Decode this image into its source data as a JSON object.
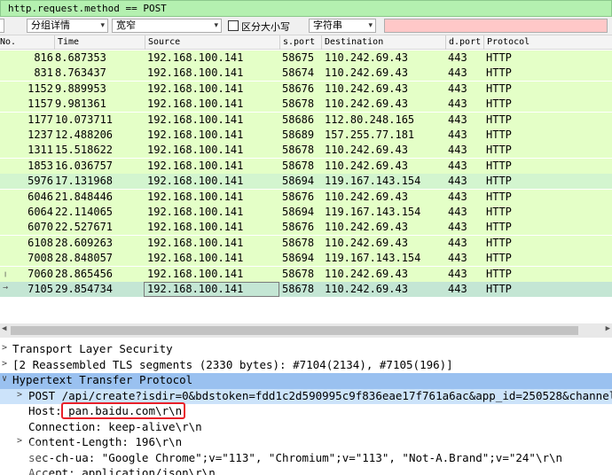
{
  "filter": {
    "text": "http.request.method == POST"
  },
  "toolbar": {
    "group_detail": "分组详情",
    "width_mode": "宽窄",
    "case_label": "区分大小写",
    "search_type": "字符串"
  },
  "columns": [
    "No.",
    "Time",
    "Source",
    "s.port",
    "Destination",
    "d.port",
    "Protocol"
  ],
  "packets": [
    {
      "no": "816",
      "time": "8.687353",
      "src": "192.168.100.141",
      "sport": "58675",
      "dst": "110.242.69.43",
      "dport": "443",
      "proto": "HTTP"
    },
    {
      "no": "831",
      "time": "8.763437",
      "src": "192.168.100.141",
      "sport": "58674",
      "dst": "110.242.69.43",
      "dport": "443",
      "proto": "HTTP"
    },
    {
      "no": "1152",
      "time": "9.889953",
      "src": "192.168.100.141",
      "sport": "58676",
      "dst": "110.242.69.43",
      "dport": "443",
      "proto": "HTTP"
    },
    {
      "no": "1157",
      "time": "9.981361",
      "src": "192.168.100.141",
      "sport": "58678",
      "dst": "110.242.69.43",
      "dport": "443",
      "proto": "HTTP"
    },
    {
      "no": "1177",
      "time": "10.073711",
      "src": "192.168.100.141",
      "sport": "58686",
      "dst": "112.80.248.165",
      "dport": "443",
      "proto": "HTTP"
    },
    {
      "no": "1237",
      "time": "12.488206",
      "src": "192.168.100.141",
      "sport": "58689",
      "dst": "157.255.77.181",
      "dport": "443",
      "proto": "HTTP"
    },
    {
      "no": "1311",
      "time": "15.518622",
      "src": "192.168.100.141",
      "sport": "58678",
      "dst": "110.242.69.43",
      "dport": "443",
      "proto": "HTTP"
    },
    {
      "no": "1853",
      "time": "16.036757",
      "src": "192.168.100.141",
      "sport": "58678",
      "dst": "110.242.69.43",
      "dport": "443",
      "proto": "HTTP"
    },
    {
      "no": "5976",
      "time": "17.131968",
      "src": "192.168.100.141",
      "sport": "58694",
      "dst": "119.167.143.154",
      "dport": "443",
      "proto": "HTTP"
    },
    {
      "no": "6046",
      "time": "21.848446",
      "src": "192.168.100.141",
      "sport": "58676",
      "dst": "110.242.69.43",
      "dport": "443",
      "proto": "HTTP"
    },
    {
      "no": "6064",
      "time": "22.114065",
      "src": "192.168.100.141",
      "sport": "58694",
      "dst": "119.167.143.154",
      "dport": "443",
      "proto": "HTTP"
    },
    {
      "no": "6070",
      "time": "22.527671",
      "src": "192.168.100.141",
      "sport": "58676",
      "dst": "110.242.69.43",
      "dport": "443",
      "proto": "HTTP"
    },
    {
      "no": "6108",
      "time": "28.609263",
      "src": "192.168.100.141",
      "sport": "58678",
      "dst": "110.242.69.43",
      "dport": "443",
      "proto": "HTTP"
    },
    {
      "no": "7008",
      "time": "28.848057",
      "src": "192.168.100.141",
      "sport": "58694",
      "dst": "119.167.143.154",
      "dport": "443",
      "proto": "HTTP"
    },
    {
      "no": "7060",
      "time": "28.865456",
      "src": "192.168.100.141",
      "sport": "58678",
      "dst": "110.242.69.43",
      "dport": "443",
      "proto": "HTTP"
    },
    {
      "no": "7105",
      "time": "29.854734",
      "src": "192.168.100.141",
      "sport": "58678",
      "dst": "110.242.69.43",
      "dport": "443",
      "proto": "HTTP"
    }
  ],
  "details": [
    {
      "expander": ">",
      "text": "Transport Layer Security",
      "indent": 0
    },
    {
      "expander": ">",
      "text": "[2 Reassembled TLS segments (2330 bytes): #7104(2134), #7105(196)]",
      "indent": 0
    },
    {
      "expander": "∨",
      "text": "Hypertext Transfer Protocol",
      "indent": 0
    },
    {
      "expander": ">",
      "text": "POST /api/create?isdir=0&bdstoken=fdd1c2d590995c9f836eae17f761a6ac&app_id=250528&channel",
      "indent": 1
    },
    {
      "expander": "",
      "text": "Host: pan.baidu.com\\r\\n",
      "indent": 1
    },
    {
      "expander": "",
      "text": "Connection: keep-alive\\r\\n",
      "indent": 1
    },
    {
      "expander": ">",
      "text": "Content-Length: 196\\r\\n",
      "indent": 1
    },
    {
      "expander": "",
      "text": "sec-ch-ua: \"Google Chrome\";v=\"113\", \"Chromium\";v=\"113\", \"Not-A.Brand\";v=\"24\"\\r\\n",
      "indent": 1
    },
    {
      "expander": "",
      "text": "Accept: application/json\\r\\n",
      "indent": 1
    }
  ],
  "colors": {
    "filter_bg": "#b4f0b0",
    "row_bg": "#e4ffc7",
    "selected_row": "#c4e6d4",
    "detail_selected": "#9ac1f0",
    "highlight_box": "#e8202a"
  }
}
